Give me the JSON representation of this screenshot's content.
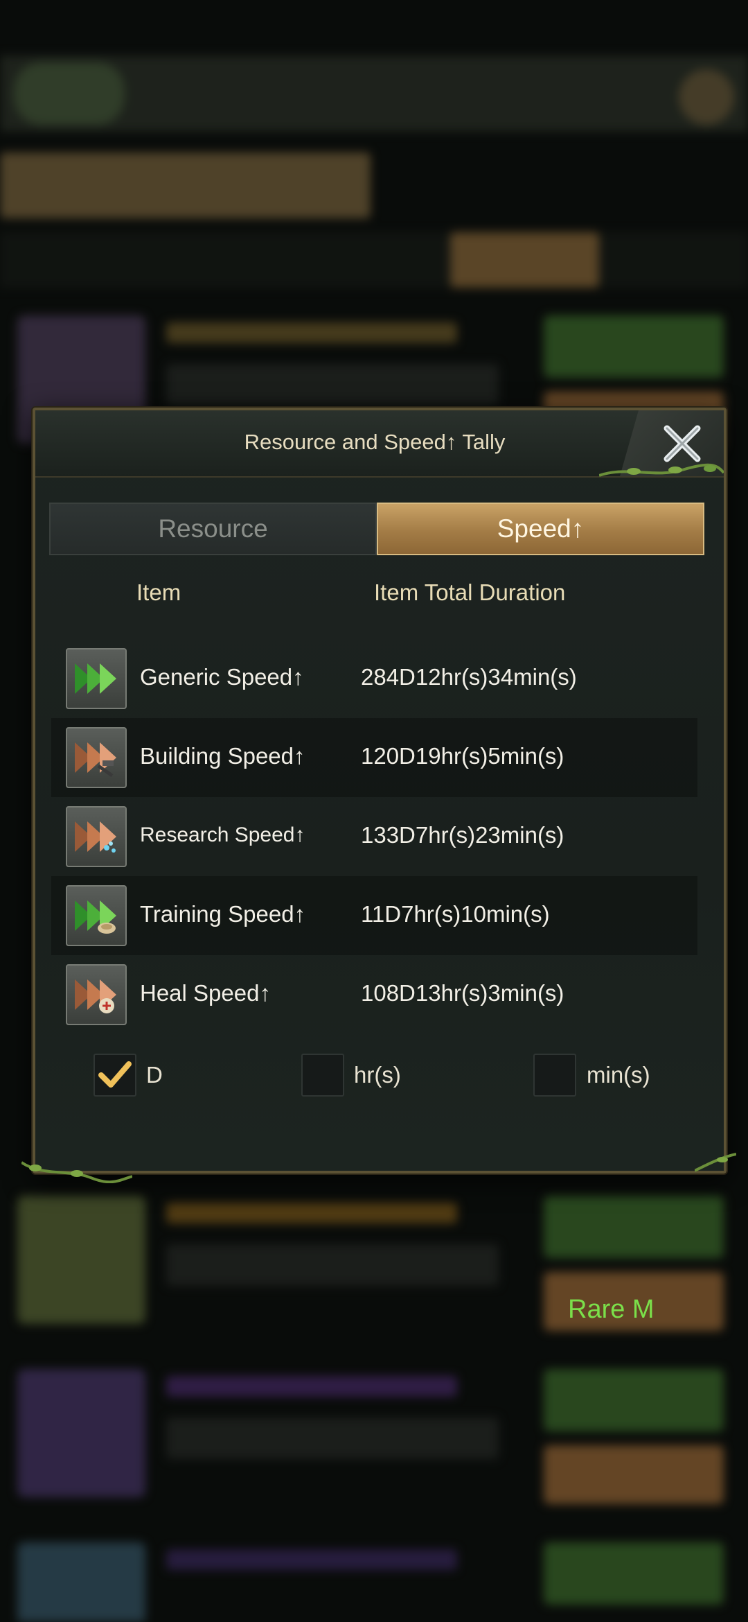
{
  "modal": {
    "title": "Resource and Speed↑ Tally",
    "tabs": [
      {
        "label": "Resource",
        "active": false
      },
      {
        "label": "Speed↑",
        "active": true
      }
    ],
    "columns": {
      "item": "Item",
      "duration": "Item Total Duration"
    },
    "rows": [
      {
        "name": "Generic Speed↑",
        "duration": "284D12hr(s)34min(s)",
        "icon": "generic-speed-icon"
      },
      {
        "name": "Building Speed↑",
        "duration": "120D19hr(s)5min(s)",
        "icon": "building-speed-icon"
      },
      {
        "name": "Research Speed↑",
        "duration": "133D7hr(s)23min(s)",
        "icon": "research-speed-icon"
      },
      {
        "name": "Training Speed↑",
        "duration": "11D7hr(s)10min(s)",
        "icon": "training-speed-icon"
      },
      {
        "name": "Heal Speed↑",
        "duration": "108D13hr(s)3min(s)",
        "icon": "heal-speed-icon"
      }
    ],
    "units": [
      {
        "label": "D",
        "checked": true
      },
      {
        "label": "hr(s)",
        "checked": false
      },
      {
        "label": "min(s)",
        "checked": false
      }
    ]
  },
  "background": {
    "badge_label": "Rare M"
  },
  "colors": {
    "accent_gold": "#c9a266",
    "panel_bg": "#1d2421",
    "text_light": "#f2efe6",
    "header_text": "#e8dcb6",
    "green_arrow": "#4caf3a",
    "copper_arrow": "#c57a4f",
    "check_mark": "#f0c15a"
  }
}
